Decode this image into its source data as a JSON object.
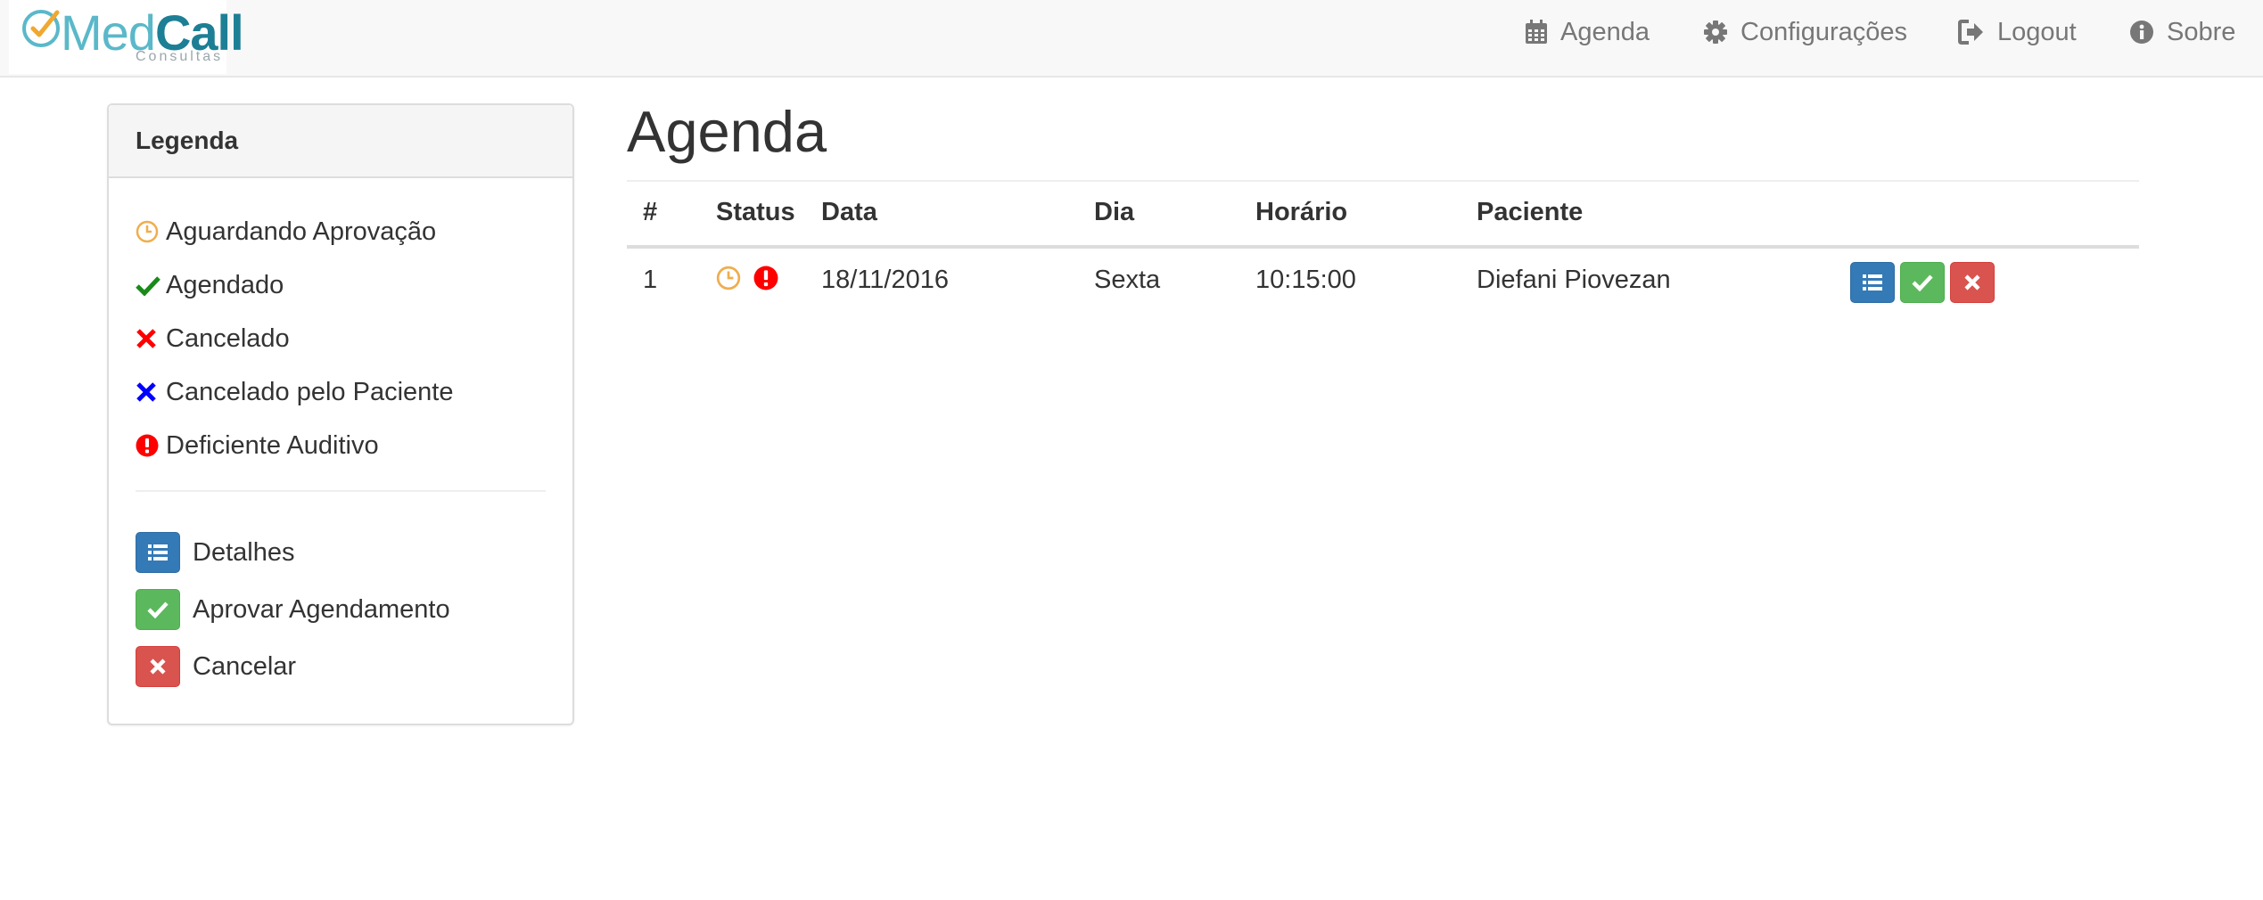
{
  "brand": {
    "name_part1": "Med",
    "name_part2": "Call",
    "subtitle": "Consultas"
  },
  "nav": {
    "items": [
      {
        "label": "Agenda",
        "icon": "calendar-icon"
      },
      {
        "label": "Configurações",
        "icon": "gear-icon"
      },
      {
        "label": "Logout",
        "icon": "logout-icon"
      },
      {
        "label": "Sobre",
        "icon": "info-icon"
      }
    ]
  },
  "legend": {
    "title": "Legenda",
    "status_items": [
      {
        "label": "Aguardando Aprovação",
        "icon": "clock-icon",
        "color": "#f0ad4e"
      },
      {
        "label": "Agendado",
        "icon": "check-icon",
        "color": "#1a8a1a"
      },
      {
        "label": "Cancelado",
        "icon": "x-icon",
        "color": "#ff0000"
      },
      {
        "label": "Cancelado pelo Paciente",
        "icon": "x-icon",
        "color": "#0000ff"
      },
      {
        "label": "Deficiente Auditivo",
        "icon": "exclamation-circle-icon",
        "color": "#ff0000"
      }
    ],
    "action_items": [
      {
        "label": "Detalhes",
        "icon": "list-icon",
        "color": "#337ab7"
      },
      {
        "label": "Aprovar Agendamento",
        "icon": "check-icon",
        "color": "#5cb85c"
      },
      {
        "label": "Cancelar",
        "icon": "x-icon",
        "color": "#d9534f"
      }
    ]
  },
  "main": {
    "title": "Agenda",
    "table": {
      "headers": [
        "#",
        "Status",
        "Data",
        "Dia",
        "Horário",
        "Paciente"
      ],
      "rows": [
        {
          "num": "1",
          "status_icons": [
            "clock-icon",
            "exclamation-circle-icon"
          ],
          "data": "18/11/2016",
          "dia": "Sexta",
          "horario": "10:15:00",
          "paciente": "Diefani Piovezan"
        }
      ]
    }
  },
  "colors": {
    "navbar_bg": "#f8f8f8",
    "brand_light": "#5ab8c9",
    "brand_dark": "#1c7f95",
    "primary": "#337ab7",
    "success": "#5cb85c",
    "danger": "#d9534f",
    "warning": "#f0ad4e"
  }
}
